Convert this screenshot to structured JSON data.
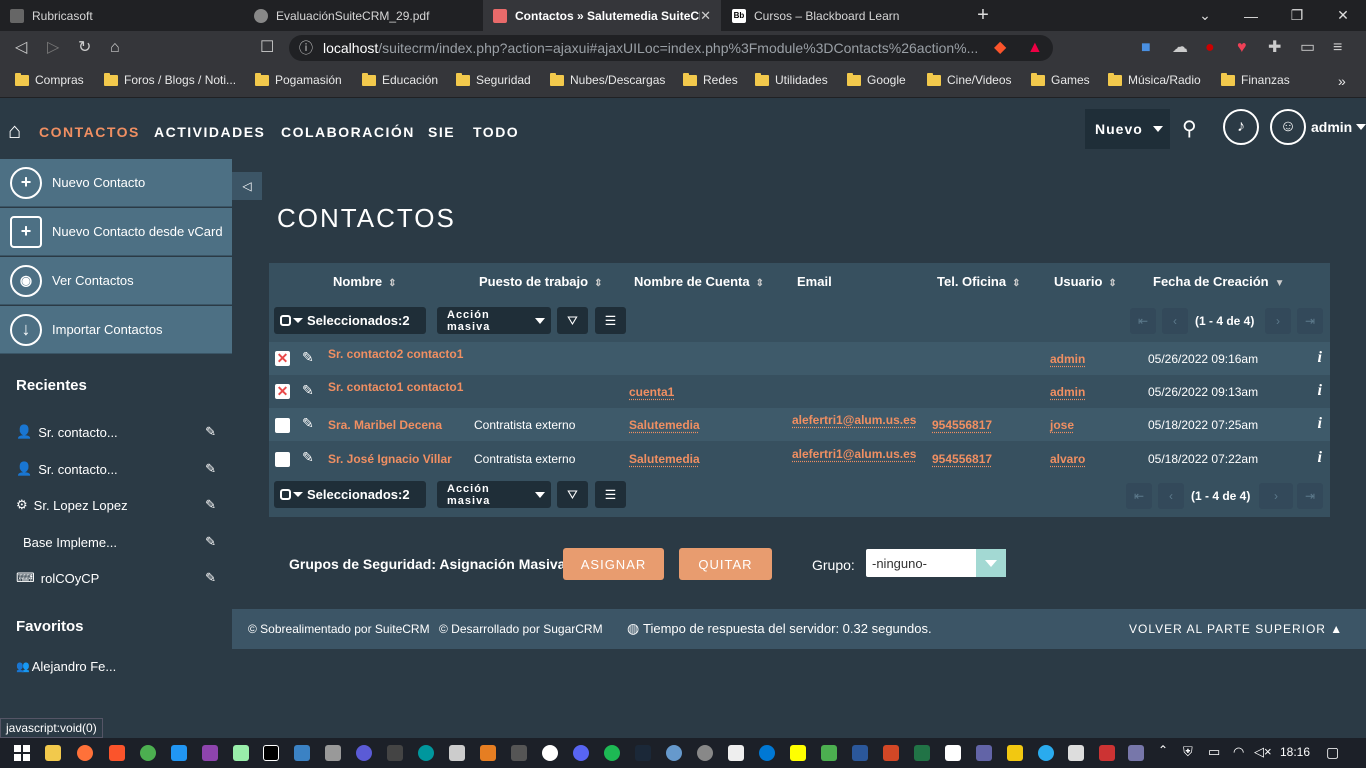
{
  "browser": {
    "tabs": [
      {
        "title": "Rubricasoft",
        "active": false
      },
      {
        "title": "EvaluaciónSuiteCRM_29.pdf",
        "active": false
      },
      {
        "title": "Contactos » Salutemedia SuiteCRM",
        "active": true
      },
      {
        "title": "Cursos – Blackboard Learn",
        "active": false
      }
    ],
    "new_tab": "+",
    "url_host": "localhost",
    "url_path": "/suitecrm/index.php?action=ajaxui#ajaxUILoc=index.php%3Fmodule%3DContacts%26action%...",
    "brave_badge": "1",
    "bookmarks": [
      "Compras",
      "Foros / Blogs / Noti...",
      "Pogamasión",
      "Educación",
      "Seguridad",
      "Nubes/Descargas",
      "Redes",
      "Utilidades",
      "Google",
      "Cine/Videos",
      "Games",
      "Música/Radio",
      "Finanzas"
    ]
  },
  "topnav": {
    "links": [
      "CONTACTOS",
      "ACTIVIDADES",
      "COLABORACIÓN",
      "SIE",
      "TODO"
    ],
    "nuevo_label": "Nuevo",
    "user": "admin"
  },
  "sidebar": {
    "actions": [
      "Nuevo Contacto",
      "Nuevo Contacto desde vCard",
      "Ver Contactos",
      "Importar Contactos"
    ],
    "recent_title": "Recientes",
    "recent": [
      "Sr. contacto...",
      "Sr. contacto...",
      "Sr. Lopez Lopez",
      "Base Impleme...",
      "rolCOyCP"
    ],
    "favorites_title": "Favoritos",
    "favorites": [
      "Alejandro Fe..."
    ]
  },
  "main": {
    "title": "CONTACTOS",
    "columns": [
      "Nombre",
      "Puesto de trabajo",
      "Nombre de Cuenta",
      "Email",
      "Tel. Oficina",
      "Usuario",
      "Fecha de Creación"
    ],
    "selected_label": "Seleccionados:2",
    "bulk_action": "Acción masiva",
    "pagination": "(1 - 4 de 4)",
    "rows": [
      {
        "name": "Sr. contacto2 contacto1",
        "title": "",
        "account": "",
        "email": "",
        "phone": "",
        "user": "admin",
        "created": "05/26/2022 09:16am",
        "checked": true
      },
      {
        "name": "Sr. contacto1 contacto1",
        "title": "",
        "account": "cuenta1",
        "email": "",
        "phone": "",
        "user": "admin",
        "created": "05/26/2022 09:13am",
        "checked": true
      },
      {
        "name": "Sra. Maribel Decena",
        "title": "Contratista externo",
        "account": "Salutemedia",
        "email": "alefertri1@alum.us.es",
        "phone": "954556817",
        "user": "jose",
        "created": "05/18/2022 07:25am",
        "checked": false
      },
      {
        "name": "Sr. José Ignacio Villar",
        "title": "Contratista externo",
        "account": "Salutemedia",
        "email": "alefertri1@alum.us.es",
        "phone": "954556817",
        "user": "alvaro",
        "created": "05/18/2022 07:22am",
        "checked": false
      }
    ],
    "security": {
      "label": "Grupos de Seguridad: Asignación Masiva",
      "assign": "ASIGNAR",
      "remove": "QUITAR",
      "group_label": "Grupo:",
      "group_value": "-ninguno-"
    }
  },
  "footer": {
    "powered": "© Sobrealimentado por SuiteCRM",
    "developed": "© Desarrollado por SugarCRM",
    "response": "Tiempo de respuesta del servidor: 0.32 segundos.",
    "back_top": "VOLVER AL PARTE SUPERIOR"
  },
  "status_text": "javascript:void(0)",
  "clock": "18:16",
  "colors": {
    "accent": "#f08f62",
    "bg": "#2b3a45",
    "row_alt": "#3e5a6a",
    "button_orange": "#e89c6f"
  }
}
